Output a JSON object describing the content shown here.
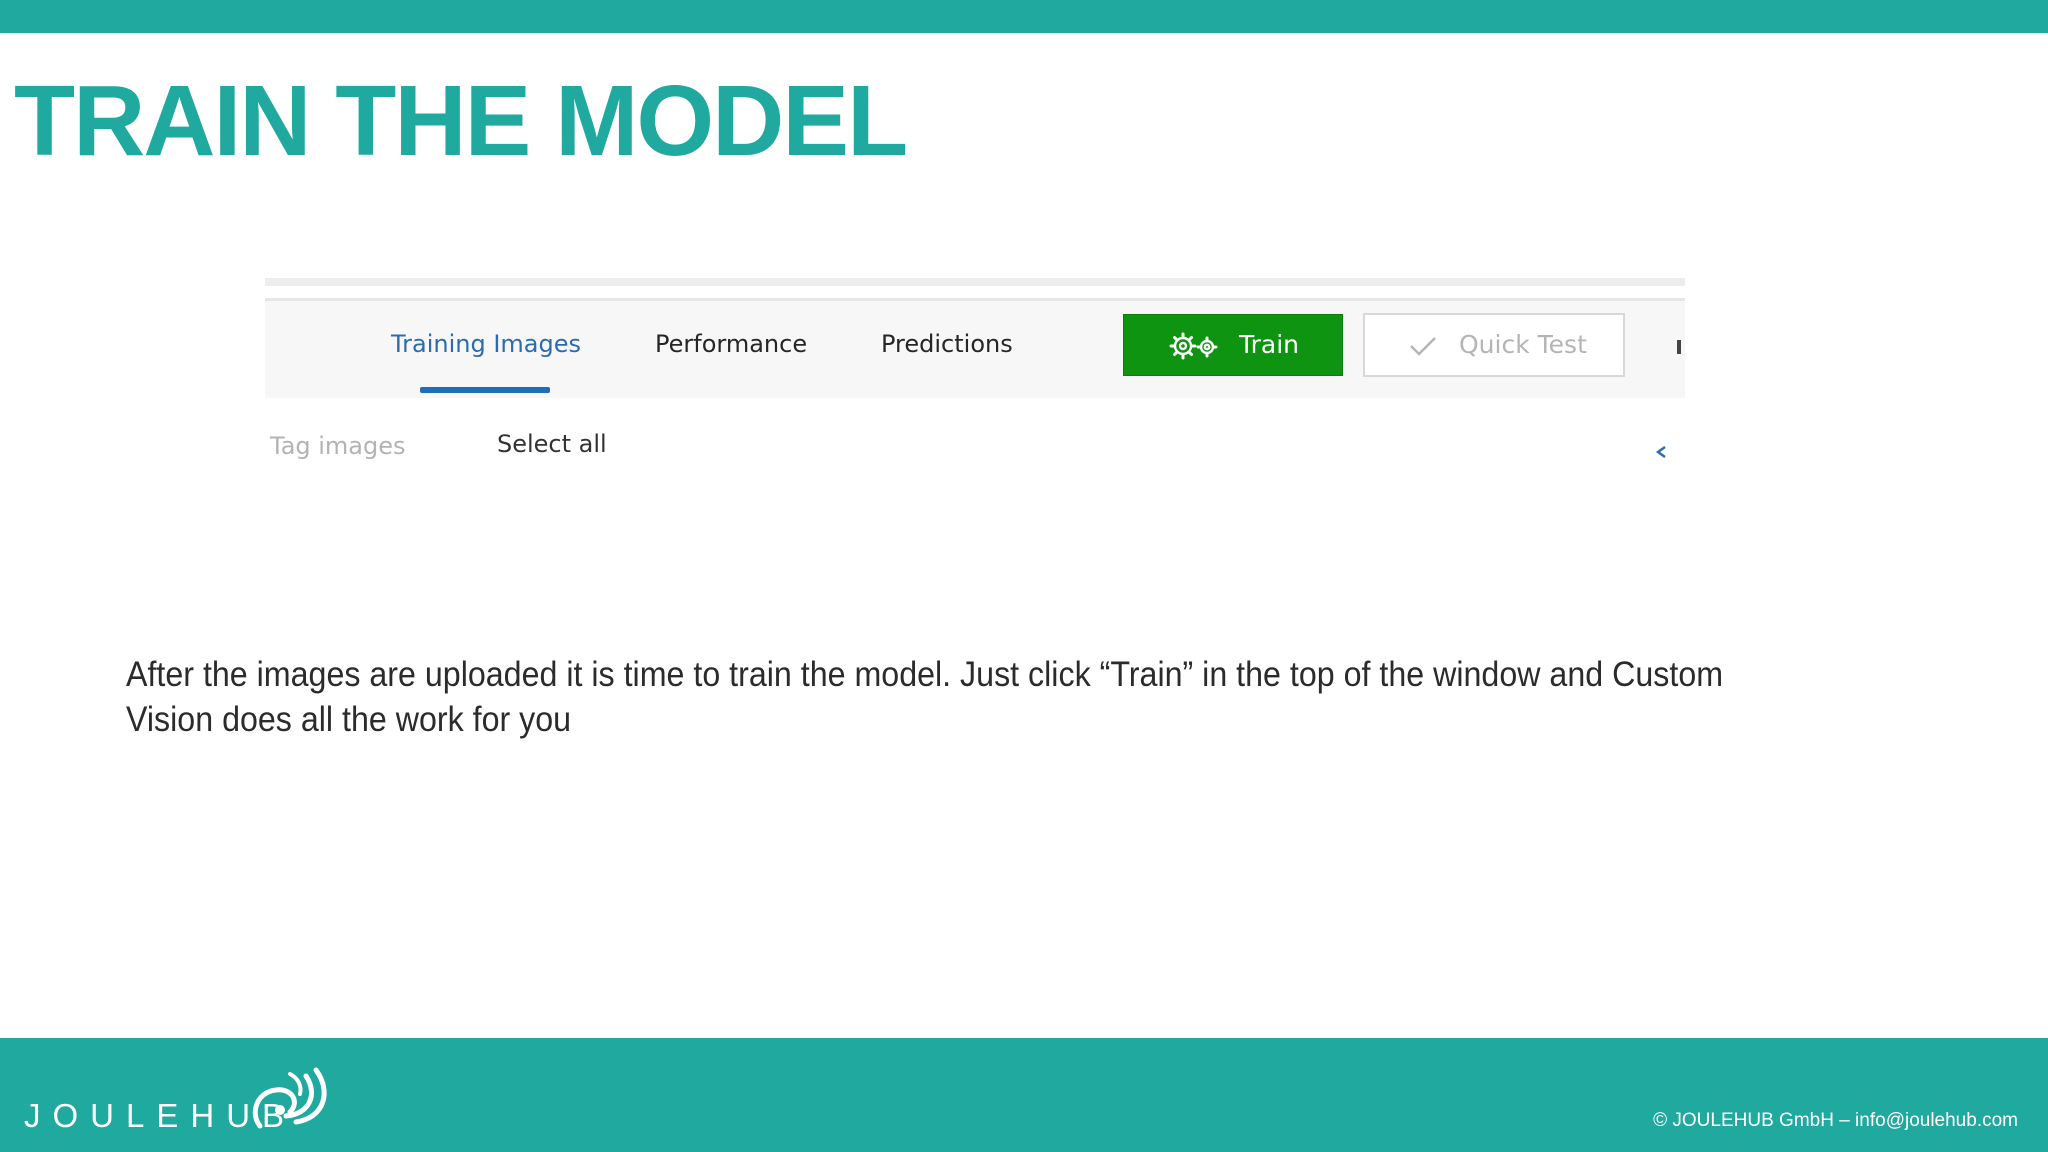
{
  "slide": {
    "title": "TRAIN THE MODEL",
    "body": "After the images are uploaded it is time to train the model. Just click “Train” in the top of the window and Custom Vision does all the work for you"
  },
  "screenshot": {
    "tabs": [
      {
        "label": "Training Images",
        "active": true
      },
      {
        "label": "Performance",
        "active": false
      },
      {
        "label": "Predictions",
        "active": false
      }
    ],
    "train_button": {
      "label": "Train",
      "icon": "gears-icon"
    },
    "quick_test_button": {
      "label": "Quick Test",
      "icon": "check-icon"
    },
    "tag_images_label": "Tag images",
    "select_all_label": "Select all",
    "collapse_icon": "chevron-left-icon"
  },
  "footer": {
    "logo_text": "JOULEHUB",
    "copyright": "© JOULEHUB GmbH – info@joulehub.com"
  },
  "colors": {
    "brand_teal": "#1fa99f",
    "train_green": "#0e9410",
    "active_tab_blue": "#2b6cb0"
  }
}
